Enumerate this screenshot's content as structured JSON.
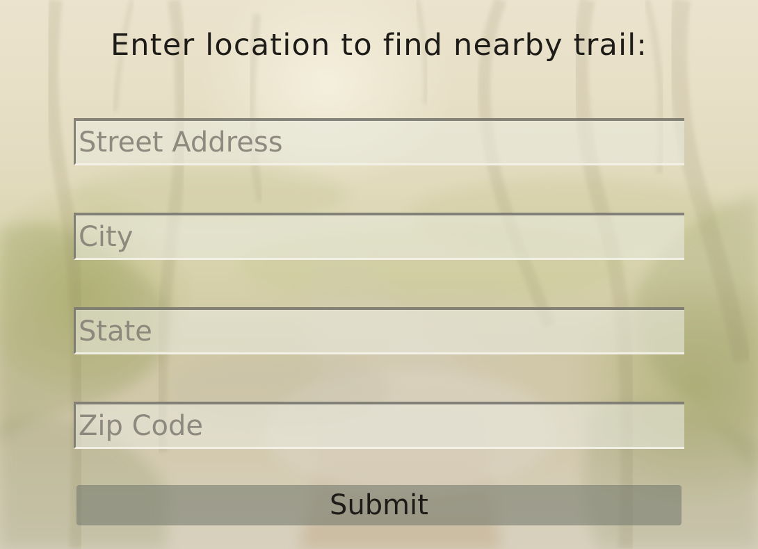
{
  "page": {
    "title": "Enter location to find nearby trail:"
  },
  "form": {
    "street_address": {
      "placeholder": "Street Address",
      "value": ""
    },
    "city": {
      "placeholder": "City",
      "value": ""
    },
    "state": {
      "placeholder": "State",
      "value": ""
    },
    "zip_code": {
      "placeholder": "Zip Code",
      "value": ""
    },
    "submit_label": "Submit"
  }
}
